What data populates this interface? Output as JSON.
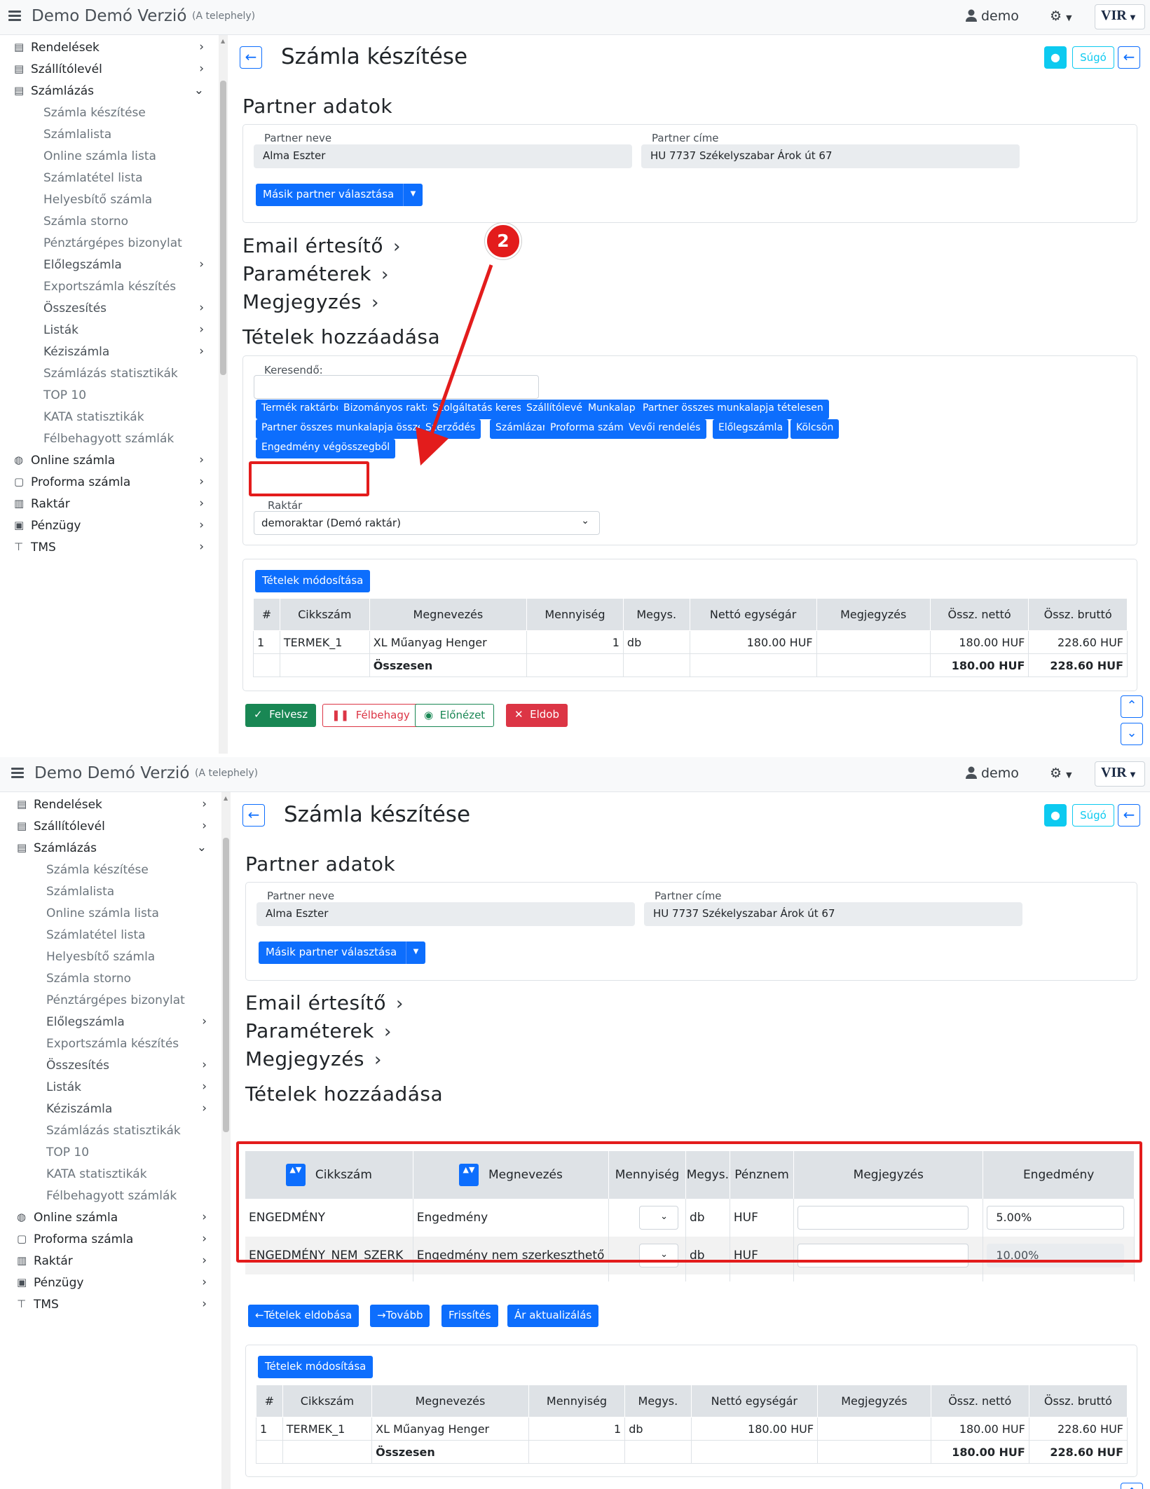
{
  "header": {
    "app_title": "Demo Demó Verzió",
    "site": "(A telephely)",
    "user": "demo",
    "logo_text": "VIR"
  },
  "sidebar": {
    "items": [
      {
        "label": "Rendelések",
        "icon": "file-icon",
        "level": "top",
        "arrow": "›"
      },
      {
        "label": "Szállítólevél",
        "icon": "clipboard-icon",
        "level": "top",
        "arrow": "›"
      },
      {
        "label": "Számlázás",
        "icon": "file-icon",
        "level": "top",
        "arrow": "⌄"
      },
      {
        "label": "Számla készítése",
        "level": "sub"
      },
      {
        "label": "Számlalista",
        "level": "sub"
      },
      {
        "label": "Online számla lista",
        "level": "sub"
      },
      {
        "label": "Számlatétel lista",
        "level": "sub"
      },
      {
        "label": "Helyesbítő számla",
        "level": "sub"
      },
      {
        "label": "Számla storno",
        "level": "sub"
      },
      {
        "label": "Pénztárgépes bizonylat",
        "level": "sub"
      },
      {
        "label": "Előlegszámla",
        "level": "subarrow",
        "arrow": "›"
      },
      {
        "label": "Exportszámla készítés",
        "level": "sub"
      },
      {
        "label": "Összesítés",
        "level": "subarrow",
        "arrow": "›"
      },
      {
        "label": "Listák",
        "level": "subarrow",
        "arrow": "›"
      },
      {
        "label": "Kéziszámla",
        "level": "subarrow",
        "arrow": "›"
      },
      {
        "label": "Számlázás statisztikák",
        "level": "sub"
      },
      {
        "label": "TOP 10",
        "level": "sub"
      },
      {
        "label": "KATA statisztikák",
        "level": "sub"
      },
      {
        "label": "Félbehagyott számlák",
        "level": "sub"
      },
      {
        "label": "Online számla",
        "icon": "globe-icon",
        "level": "top",
        "arrow": "›"
      },
      {
        "label": "Proforma számla",
        "icon": "document-icon",
        "level": "top",
        "arrow": "›"
      },
      {
        "label": "Raktár",
        "icon": "warehouse-icon",
        "level": "top",
        "arrow": "›"
      },
      {
        "label": "Pénzügy",
        "icon": "money-icon",
        "level": "top",
        "arrow": "›"
      },
      {
        "label": "TMS",
        "icon": "pin-icon",
        "level": "top",
        "arrow": "›"
      }
    ]
  },
  "page": {
    "title": "Számla készítése",
    "sugo_label": "Súgó"
  },
  "partner": {
    "section_title": "Partner adatok",
    "name_label": "Partner neve",
    "name_value": "Alma Eszter",
    "address_label": "Partner címe",
    "address_value": "HU 7737 Székelyszabar Árok út 67",
    "other_partner_button": "Másik partner választása"
  },
  "sections": {
    "email": "Email értesítő",
    "params": "Paraméterek",
    "note": "Megjegyzés",
    "add_items": "Tételek hozzáadása"
  },
  "add_items": {
    "search_label": "Keresendő:",
    "buttons": [
      "Termék raktárból",
      "Bizományos raktár",
      "Szolgáltatás keresés",
      "Szállítólevél",
      "Munkalap",
      "Partner összes munkalapja tételesen",
      "Partner összes munkalapja összesítve",
      "Szerződés",
      "Számlázandó",
      "Proforma számla",
      "Vevői rendelés",
      "Előlegszámla",
      "Kölcsön",
      "Engedmény végösszegből"
    ],
    "warehouse_label": "Raktár",
    "warehouse_value": "demoraktar (Demó raktár)"
  },
  "annotation": {
    "step": "2"
  },
  "items_table": {
    "modify_button": "Tételek módosítása",
    "headers": [
      "#",
      "Cikkszám",
      "Megnevezés",
      "Mennyiség",
      "Megys.",
      "Nettó egységár",
      "Megjegyzés",
      "Össz. nettó",
      "Össz. bruttó"
    ],
    "rows": [
      [
        "1",
        "TERMEK_1",
        "XL Műanyag Henger",
        "1",
        "db",
        "180.00 HUF",
        "",
        "180.00 HUF",
        "228.60 HUF"
      ]
    ],
    "total_label": "Összesen",
    "total_net": "180.00 HUF",
    "total_gross": "228.60 HUF"
  },
  "actions": {
    "felvesz": "Felvesz",
    "felbehagy": "Félbehagy",
    "elonezet": "Előnézet",
    "eldob": "Eldob"
  },
  "discount_table": {
    "headers": [
      "Cikkszám",
      "Megnevezés",
      "Mennyiség",
      "Megys.",
      "Pénznem",
      "Megjegyzés",
      "Engedmény"
    ],
    "rows": [
      {
        "code": "ENGEDMÉNY",
        "name": "Engedmény",
        "unit": "db",
        "currency": "HUF",
        "discount": "5.00%"
      },
      {
        "code": "ENGEDMÉNY_NEM_SZERK",
        "name": "Engedmény nem szerkeszthető",
        "unit": "db",
        "currency": "HUF",
        "discount": "10.00%"
      }
    ]
  },
  "discount_actions": {
    "remove": "Tételek eldobása",
    "next": "Tovább",
    "refresh": "Frissítés",
    "price_update": "Ár aktualizálás"
  },
  "colors": {
    "primary": "#0d6efd",
    "success": "#198754",
    "danger": "#dc3545",
    "info": "#0dcaf0",
    "highlight": "#e31c1c"
  }
}
